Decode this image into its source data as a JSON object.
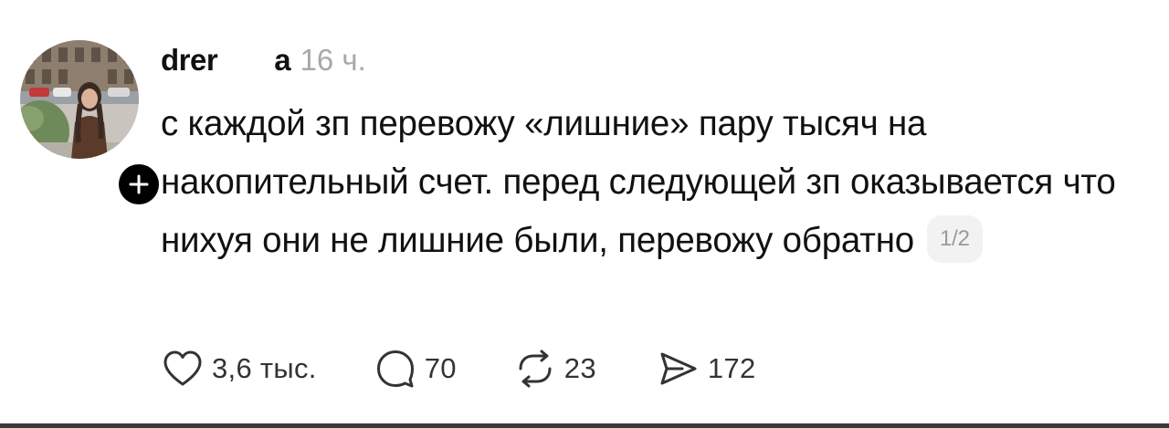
{
  "post": {
    "username": "drer",
    "author_prefix": "а",
    "time": "16 ч.",
    "text": "с каждой зп перевожу «лишние» пару тысяч на накопительный счет. перед следующей зп оказывается что нихуя они не лишние были, перевожу обратно",
    "page_indicator": "1/2",
    "actions": {
      "like_count": "3,6 тыс.",
      "comment_count": "70",
      "repost_count": "23",
      "share_count": "172"
    }
  },
  "icons": {
    "follow": "plus-icon",
    "like": "heart-icon",
    "comment": "comment-bubble-icon",
    "repost": "repost-icon",
    "share": "send-icon"
  }
}
